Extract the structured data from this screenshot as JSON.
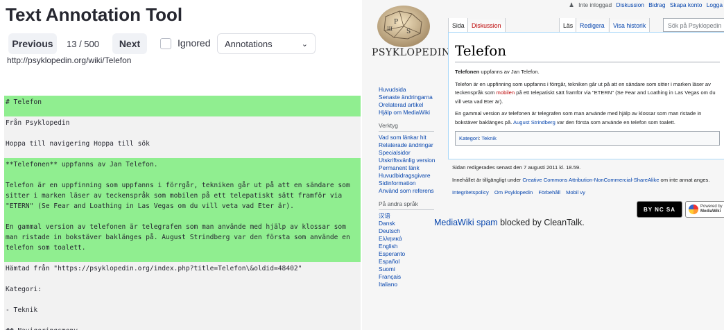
{
  "tool": {
    "title": "Text Annotation Tool",
    "prev_label": "Previous",
    "counter": "13 / 500",
    "next_label": "Next",
    "ignored_label": "Ignored",
    "select_value": "Annotations",
    "url": "http://psyklopedin.org/wiki/Telefon"
  },
  "annotations": [
    {
      "text": "# Telefon",
      "color": "green"
    },
    {
      "text": "Från Psyklopedin",
      "color": "white"
    },
    {
      "text": "Hoppa till navigering Hoppa till sök",
      "color": "white"
    },
    {
      "text": "**Telefonen** uppfanns av Jan Telefon.",
      "color": "green"
    },
    {
      "text": "Telefon är en uppfinning som uppfanns i förrgår, tekniken går ut på att en sändare som sitter i marken läser av teckenspråk som mobilen på ett telepatiskt sätt framför via \"ETERN\" (Se Fear and Loathing in Las Vegas om du vill veta vad Eter är).",
      "color": "green"
    },
    {
      "text": "En gammal version av telefonen är telegrafen som man använde med hjälp av klossar som man ristade in bokstäver baklänges på. August Strindberg var den första som använde en telefon som toalett.",
      "color": "green"
    },
    {
      "text": "Hämtad från \"https://psyklopedin.org/index.php?title=Telefon\\&oldid=48402\"",
      "color": "white"
    },
    {
      "text": "Kategori:",
      "color": "white"
    },
    {
      "text": "- Teknik",
      "color": "white"
    },
    {
      "text": "## Navigeringsmeny",
      "color": "white"
    }
  ],
  "wiki": {
    "logo_text": "PSYKLOPEDIN",
    "personal": {
      "user": "Inte inloggad",
      "links": [
        "Diskussion",
        "Bidrag",
        "Skapa konto",
        "Logga"
      ]
    },
    "tabs": {
      "page": "Sida",
      "talk": "Diskussion",
      "read": "Läs",
      "edit": "Redigera",
      "history": "Visa historik"
    },
    "search_placeholder": "Sök på Psyklopedin",
    "heading": "Telefon",
    "intro_bold": "Telefonen",
    "intro_rest": " uppfanns av Jan Telefon.",
    "p2_a": "Telefon är en uppfinning som uppfanns i förrgår, tekniken går ut på att en sändare som sitter i marken läser av teckenspråk som ",
    "p2_link": "mobilen",
    "p2_b": " på ett telepatiskt sätt framför via \"ETERN\" (Se Fear and Loathing in Las Vegas om du vill veta vad Eter är).",
    "p3_a": "En gammal version av telefonen är telegrafen som man använde med hjälp av klossar som man ristade in bokstäver baklänges på. ",
    "p3_link": "August Strindberg",
    "p3_b": " var den första som använde en telefon som toalett.",
    "cat_label": "Kategori",
    "cat_value": "Teknik",
    "sidebar_main": [
      "Huvudsida",
      "Senaste ändringarna",
      "Orelaterad artikel",
      "Hjälp om MediaWiki"
    ],
    "sidebar_tools_heading": "Verktyg",
    "sidebar_tools": [
      "Vad som länkar hit",
      "Relaterade ändringar",
      "Specialsidor",
      "Utskriftsvänlig version",
      "Permanent länk",
      "Huvudbidragsgivare",
      "Sidinformation",
      "Använd som referens"
    ],
    "sidebar_lang_heading": "På andra språk",
    "sidebar_langs": [
      "汉语",
      "Dansk",
      "Deutsch",
      "Ελληνικά",
      "English",
      "Esperanto",
      "Español",
      "Suomi",
      "Français",
      "Italiano"
    ],
    "footer_edited": "Sidan redigerades senast den 7 augusti 2011 kl. 18.59.",
    "footer_license_a": "Innehållet är tillgängligt under ",
    "footer_license_link": "Creative Commons Attribution-NonCommercial-ShareAlike",
    "footer_license_b": " om inte annat anges.",
    "footer_links": [
      "Integritetspolicy",
      "Om Psyklopedin",
      "Förbehåll",
      "Mobil vy"
    ],
    "cc_badge": "BY NC SA",
    "mw_badge_a": "Powered by",
    "mw_badge_b": "MediaWiki",
    "cleantalk_link": "MediaWiki spam",
    "cleantalk_rest": " blocked by CleanTalk."
  }
}
